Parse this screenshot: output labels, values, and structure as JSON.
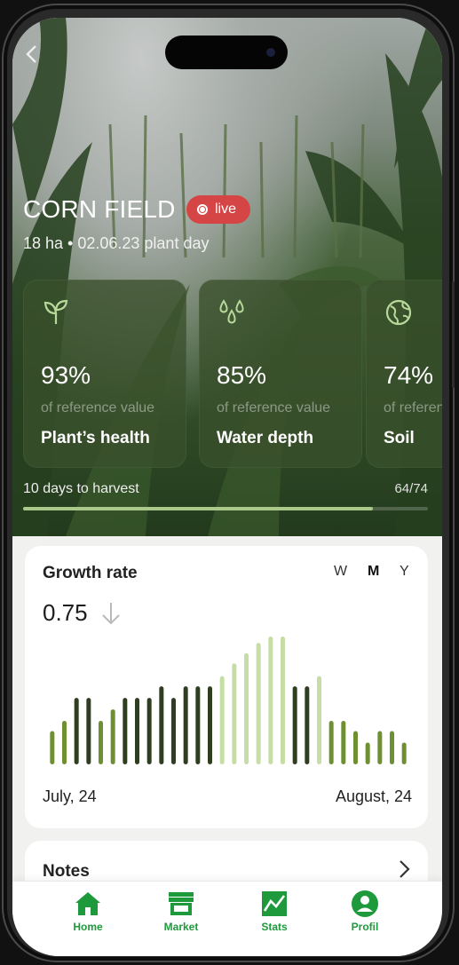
{
  "field": {
    "title": "CORN FIELD",
    "live_label": "live",
    "meta": "18 ha  •  02.06.23 plant day",
    "back_icon": "chevron-left-icon"
  },
  "cards": [
    {
      "icon": "sprout-icon",
      "value": "93%",
      "sub": "of reference value",
      "label": "Plant’s health"
    },
    {
      "icon": "water-drops-icon",
      "value": "85%",
      "sub": "of reference value",
      "label": "Water depth"
    },
    {
      "icon": "globe-icon",
      "value": "74%",
      "sub": "of reference value",
      "label": "Soil"
    }
  ],
  "harvest": {
    "text": "10 days to harvest",
    "count": "64/74",
    "progress": 0.865
  },
  "growth": {
    "title": "Growth rate",
    "periods": [
      "W",
      "M",
      "Y"
    ],
    "active_period": "M",
    "value": "0.75",
    "trend_icon": "arrow-down-icon",
    "start_label": "July, 24",
    "end_label": "August, 24"
  },
  "chart_data": {
    "type": "bar",
    "series": [
      {
        "values": [
          0.26,
          0.34,
          0.52,
          0.52,
          0.34,
          0.43,
          0.52,
          0.52,
          0.52,
          0.61,
          0.52,
          0.61,
          0.61,
          0.61,
          0.69,
          0.79,
          0.87,
          0.95,
          1.0,
          1.0,
          0.61,
          0.61,
          0.69,
          0.34,
          0.34,
          0.26,
          0.17,
          0.26,
          0.26,
          0.17
        ],
        "shades": [
          "mid",
          "mid",
          "dark",
          "dark",
          "mid",
          "mid",
          "dark",
          "dark",
          "dark",
          "dark",
          "dark",
          "dark",
          "dark",
          "dark",
          "light",
          "light",
          "light",
          "light",
          "light",
          "light",
          "dark",
          "dark",
          "light",
          "mid",
          "mid",
          "mid",
          "mid",
          "mid",
          "mid",
          "mid"
        ]
      }
    ],
    "colors": {
      "dark": "#2f3d21",
      "mid": "#6f8f33",
      "light": "#c6dea5"
    }
  },
  "notes": {
    "label": "Notes",
    "chevron_icon": "chevron-right-icon"
  },
  "tabs": [
    {
      "label": "Home",
      "icon": "home-icon"
    },
    {
      "label": "Market",
      "icon": "store-icon"
    },
    {
      "label": "Stats",
      "icon": "stats-icon"
    },
    {
      "label": "Profil",
      "icon": "profile-icon"
    }
  ],
  "colors": {
    "accent": "#1e9a3c",
    "live": "#d64545"
  }
}
